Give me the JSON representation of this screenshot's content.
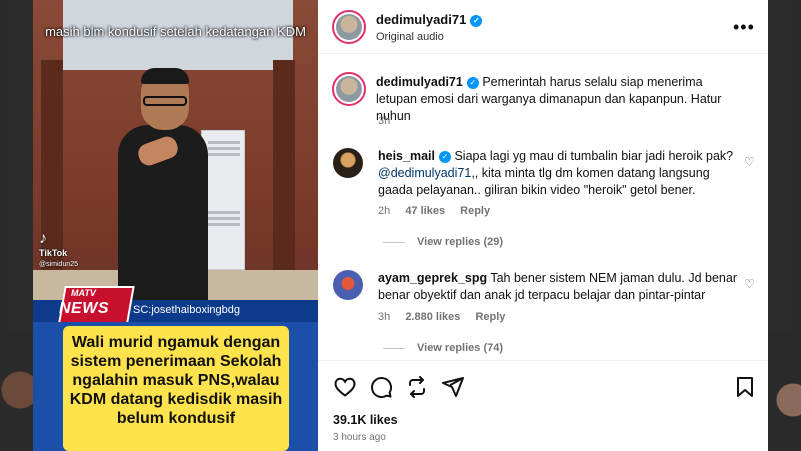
{
  "video": {
    "overlay_text": "masih blm kondusif setelah kedatangan KDM",
    "tiktok_label": "TikTok",
    "tiktok_user": "@simidun25",
    "news_logo_top": "MATV",
    "news_logo_main": "NEWS",
    "source": "SC:josethaiboxingbdg",
    "headline": "Wali murid ngamuk dengan sistem penerimaan Sekolah ngalahin masuk PNS,walau KDM datang kedisdik masih belum kondusif"
  },
  "post": {
    "author": "dedimulyadi71",
    "audio": "Original audio",
    "more_icon": "more-horizontal-icon"
  },
  "caption": {
    "author": "dedimulyadi71",
    "text": "Pemerintah harus selalu siap menerima letupan emosi dari warganya dimanapun dan kapanpun. Hatur nuhun",
    "time": "3h"
  },
  "comments": [
    {
      "author": "heis_mail",
      "verified": true,
      "text_before": "Siapa lagi yg mau di tumbalin biar jadi heroik pak?",
      "mention": "@dedimulyadi71",
      "text_after": ",, kita minta tlg dm komen datang langsung gaada pelayanan.. giliran bikin video \"heroik\" getol bener.",
      "time": "2h",
      "likes": "47 likes",
      "reply_label": "Reply",
      "view_replies": "View replies (29)"
    },
    {
      "author": "ayam_geprek_spg",
      "verified": false,
      "text": "Tah bener sistem NEM jaman dulu. Jd benar benar obyektif dan anak jd terpacu belajar dan pintar-pintar",
      "time": "3h",
      "likes": "2.880 likes",
      "reply_label": "Reply",
      "view_replies": "View replies (74)"
    }
  ],
  "footer": {
    "likes": "39.1K likes",
    "time": "3 hours ago"
  },
  "colors": {
    "verified": "#0095f6",
    "mention": "#00376b",
    "headline_bg": "#ffe34d",
    "news_red": "#c8102e"
  }
}
